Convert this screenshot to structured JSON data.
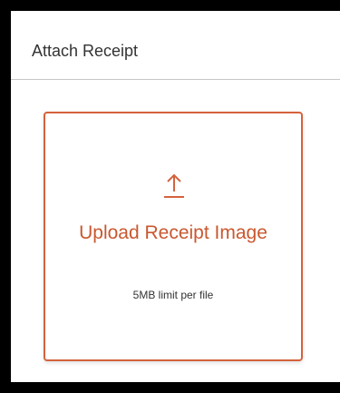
{
  "dialog": {
    "title": "Attach Receipt"
  },
  "upload": {
    "icon": "upload-arrow-icon",
    "label": "Upload Receipt Image",
    "limit_text": "5MB limit per file"
  },
  "colors": {
    "accent": "#d5623c",
    "text": "#333333",
    "frame": "#000000"
  }
}
